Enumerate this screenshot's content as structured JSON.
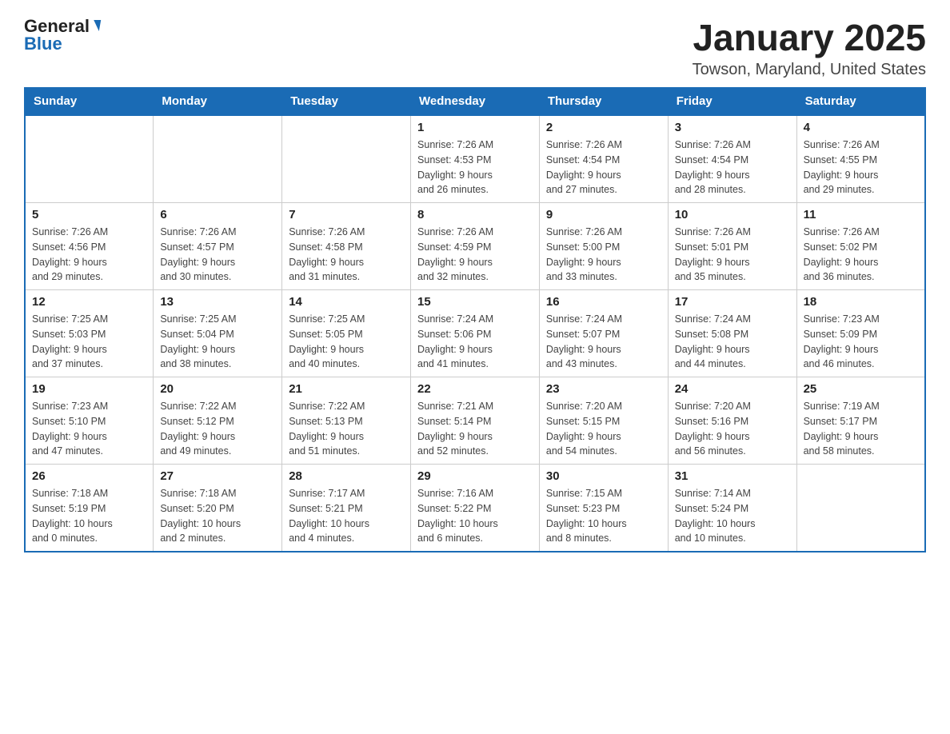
{
  "header": {
    "logo_text_main": "General",
    "logo_text_blue": "Blue",
    "month_title": "January 2025",
    "location": "Towson, Maryland, United States"
  },
  "days_of_week": [
    "Sunday",
    "Monday",
    "Tuesday",
    "Wednesday",
    "Thursday",
    "Friday",
    "Saturday"
  ],
  "weeks": [
    [
      {
        "day": "",
        "info": ""
      },
      {
        "day": "",
        "info": ""
      },
      {
        "day": "",
        "info": ""
      },
      {
        "day": "1",
        "info": "Sunrise: 7:26 AM\nSunset: 4:53 PM\nDaylight: 9 hours\nand 26 minutes."
      },
      {
        "day": "2",
        "info": "Sunrise: 7:26 AM\nSunset: 4:54 PM\nDaylight: 9 hours\nand 27 minutes."
      },
      {
        "day": "3",
        "info": "Sunrise: 7:26 AM\nSunset: 4:54 PM\nDaylight: 9 hours\nand 28 minutes."
      },
      {
        "day": "4",
        "info": "Sunrise: 7:26 AM\nSunset: 4:55 PM\nDaylight: 9 hours\nand 29 minutes."
      }
    ],
    [
      {
        "day": "5",
        "info": "Sunrise: 7:26 AM\nSunset: 4:56 PM\nDaylight: 9 hours\nand 29 minutes."
      },
      {
        "day": "6",
        "info": "Sunrise: 7:26 AM\nSunset: 4:57 PM\nDaylight: 9 hours\nand 30 minutes."
      },
      {
        "day": "7",
        "info": "Sunrise: 7:26 AM\nSunset: 4:58 PM\nDaylight: 9 hours\nand 31 minutes."
      },
      {
        "day": "8",
        "info": "Sunrise: 7:26 AM\nSunset: 4:59 PM\nDaylight: 9 hours\nand 32 minutes."
      },
      {
        "day": "9",
        "info": "Sunrise: 7:26 AM\nSunset: 5:00 PM\nDaylight: 9 hours\nand 33 minutes."
      },
      {
        "day": "10",
        "info": "Sunrise: 7:26 AM\nSunset: 5:01 PM\nDaylight: 9 hours\nand 35 minutes."
      },
      {
        "day": "11",
        "info": "Sunrise: 7:26 AM\nSunset: 5:02 PM\nDaylight: 9 hours\nand 36 minutes."
      }
    ],
    [
      {
        "day": "12",
        "info": "Sunrise: 7:25 AM\nSunset: 5:03 PM\nDaylight: 9 hours\nand 37 minutes."
      },
      {
        "day": "13",
        "info": "Sunrise: 7:25 AM\nSunset: 5:04 PM\nDaylight: 9 hours\nand 38 minutes."
      },
      {
        "day": "14",
        "info": "Sunrise: 7:25 AM\nSunset: 5:05 PM\nDaylight: 9 hours\nand 40 minutes."
      },
      {
        "day": "15",
        "info": "Sunrise: 7:24 AM\nSunset: 5:06 PM\nDaylight: 9 hours\nand 41 minutes."
      },
      {
        "day": "16",
        "info": "Sunrise: 7:24 AM\nSunset: 5:07 PM\nDaylight: 9 hours\nand 43 minutes."
      },
      {
        "day": "17",
        "info": "Sunrise: 7:24 AM\nSunset: 5:08 PM\nDaylight: 9 hours\nand 44 minutes."
      },
      {
        "day": "18",
        "info": "Sunrise: 7:23 AM\nSunset: 5:09 PM\nDaylight: 9 hours\nand 46 minutes."
      }
    ],
    [
      {
        "day": "19",
        "info": "Sunrise: 7:23 AM\nSunset: 5:10 PM\nDaylight: 9 hours\nand 47 minutes."
      },
      {
        "day": "20",
        "info": "Sunrise: 7:22 AM\nSunset: 5:12 PM\nDaylight: 9 hours\nand 49 minutes."
      },
      {
        "day": "21",
        "info": "Sunrise: 7:22 AM\nSunset: 5:13 PM\nDaylight: 9 hours\nand 51 minutes."
      },
      {
        "day": "22",
        "info": "Sunrise: 7:21 AM\nSunset: 5:14 PM\nDaylight: 9 hours\nand 52 minutes."
      },
      {
        "day": "23",
        "info": "Sunrise: 7:20 AM\nSunset: 5:15 PM\nDaylight: 9 hours\nand 54 minutes."
      },
      {
        "day": "24",
        "info": "Sunrise: 7:20 AM\nSunset: 5:16 PM\nDaylight: 9 hours\nand 56 minutes."
      },
      {
        "day": "25",
        "info": "Sunrise: 7:19 AM\nSunset: 5:17 PM\nDaylight: 9 hours\nand 58 minutes."
      }
    ],
    [
      {
        "day": "26",
        "info": "Sunrise: 7:18 AM\nSunset: 5:19 PM\nDaylight: 10 hours\nand 0 minutes."
      },
      {
        "day": "27",
        "info": "Sunrise: 7:18 AM\nSunset: 5:20 PM\nDaylight: 10 hours\nand 2 minutes."
      },
      {
        "day": "28",
        "info": "Sunrise: 7:17 AM\nSunset: 5:21 PM\nDaylight: 10 hours\nand 4 minutes."
      },
      {
        "day": "29",
        "info": "Sunrise: 7:16 AM\nSunset: 5:22 PM\nDaylight: 10 hours\nand 6 minutes."
      },
      {
        "day": "30",
        "info": "Sunrise: 7:15 AM\nSunset: 5:23 PM\nDaylight: 10 hours\nand 8 minutes."
      },
      {
        "day": "31",
        "info": "Sunrise: 7:14 AM\nSunset: 5:24 PM\nDaylight: 10 hours\nand 10 minutes."
      },
      {
        "day": "",
        "info": ""
      }
    ]
  ]
}
